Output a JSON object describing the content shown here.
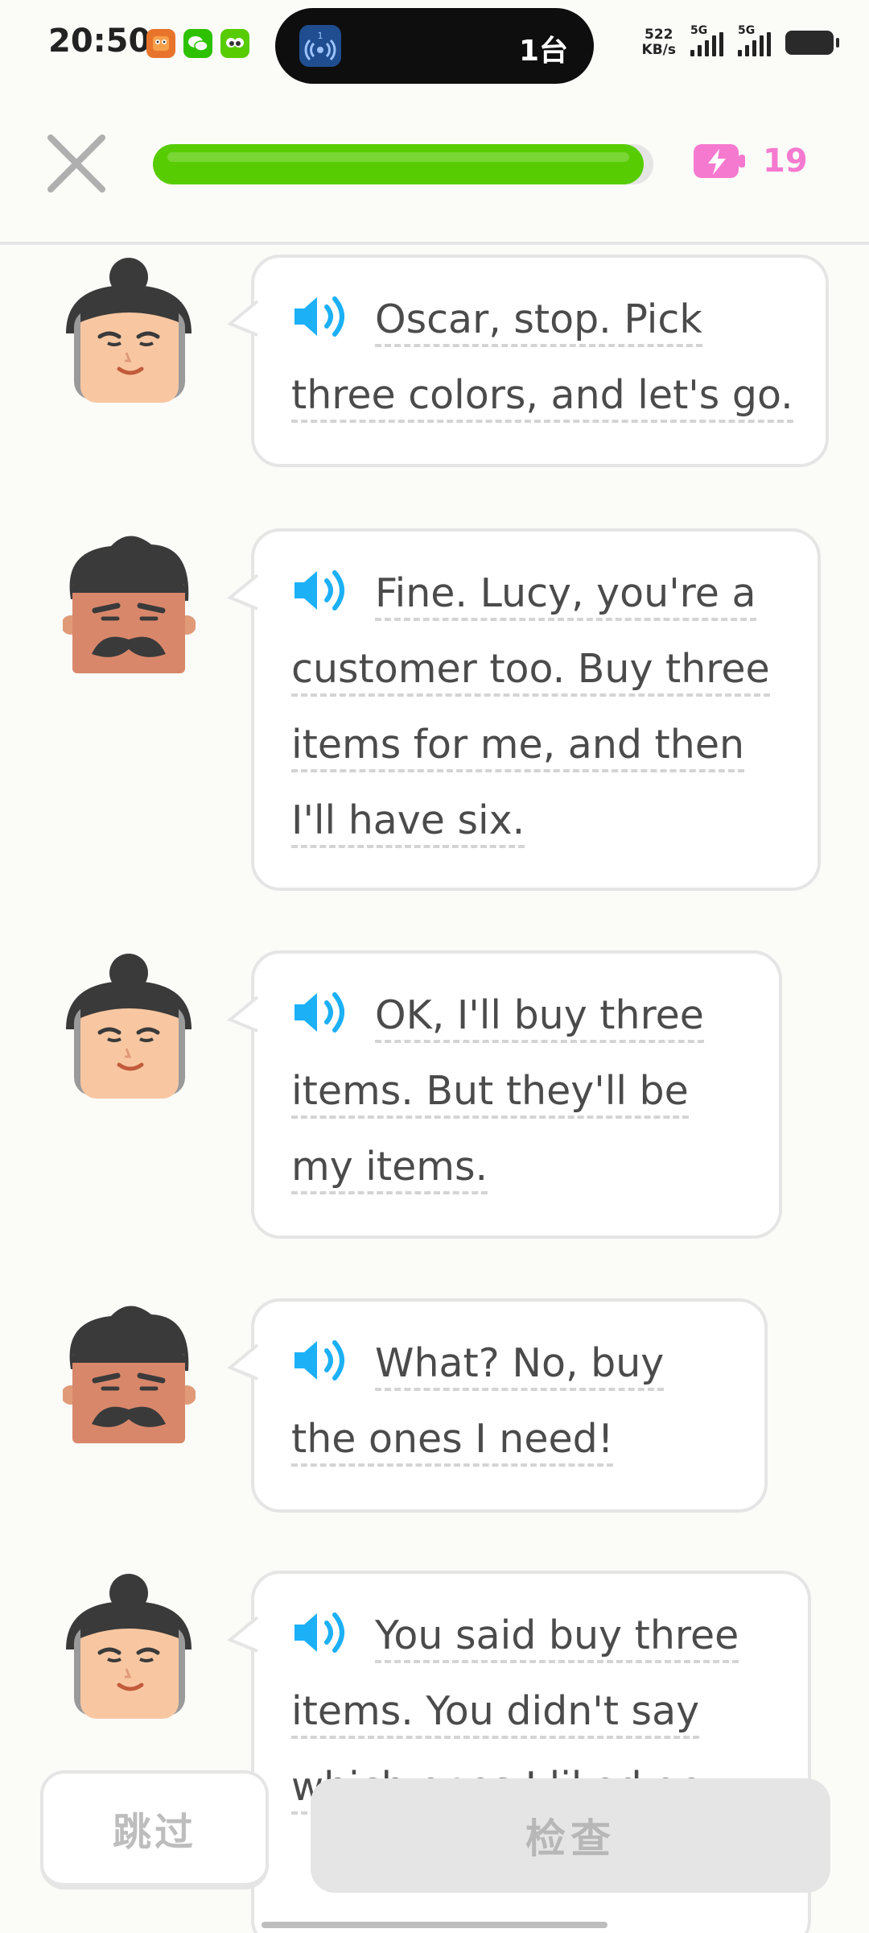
{
  "status_bar": {
    "time": "20:50",
    "pill_badge": "1",
    "pill_text": "1台",
    "net_speed_value": "522",
    "net_speed_unit": "KB/s",
    "sim1_label": "5G",
    "sim2_label": "5G"
  },
  "header": {
    "progress": 0.98,
    "energy_count": "19",
    "accent_progress": "#58CC02",
    "accent_energy": "#F57ACF"
  },
  "messages": [
    {
      "speaker": "lucy",
      "text": "Oscar, stop. Pick three colors, and let's go."
    },
    {
      "speaker": "oscar",
      "text": "Fine. Lucy, you're a customer too. Buy three items for me, and then I'll have six."
    },
    {
      "speaker": "lucy",
      "text": "OK, I'll buy three items. But they'll be my items."
    },
    {
      "speaker": "oscar",
      "text": "What? No, buy the ones I need!"
    },
    {
      "speaker": "lucy",
      "text": "You said buy three items. You didn't say which ones I liked go..."
    }
  ],
  "buttons": {
    "skip_label": "跳过",
    "check_label": "检查"
  }
}
